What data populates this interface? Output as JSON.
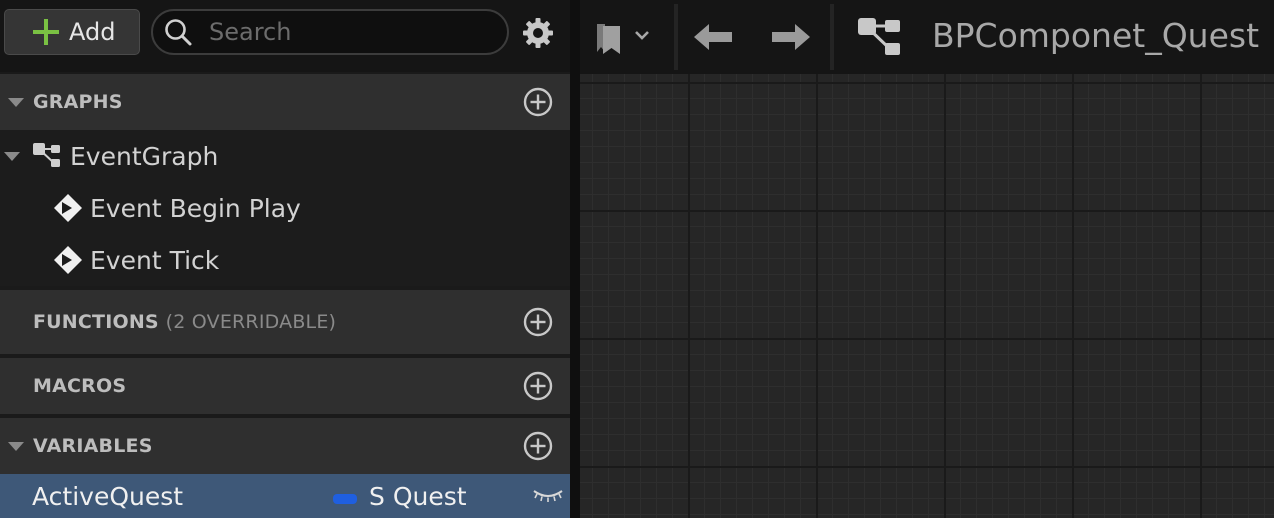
{
  "left_panel": {
    "add_button_label": "Add",
    "search_placeholder": "Search",
    "sections": {
      "graphs": {
        "title": "GRAPHS"
      },
      "functions": {
        "title": "FUNCTIONS",
        "subtitle": "(2 OVERRIDABLE)"
      },
      "macros": {
        "title": "MACROS"
      },
      "variables": {
        "title": "VARIABLES"
      }
    },
    "graph_items": [
      {
        "label": "EventGraph",
        "icon": "graph-icon"
      },
      {
        "label": "Event Begin Play",
        "icon": "event-icon"
      },
      {
        "label": "Event Tick",
        "icon": "event-icon"
      }
    ],
    "variables": [
      {
        "name": "ActiveQuest",
        "type": "S Quest",
        "type_color": "#1f5fe0",
        "visibility_icon": "eye-closed-icon"
      }
    ]
  },
  "editor": {
    "tab_title": "BPComponet_Quest"
  },
  "colors": {
    "accent_green": "#7ac143",
    "selection": "#3e5878",
    "struct_pin": "#1f5fe0"
  }
}
